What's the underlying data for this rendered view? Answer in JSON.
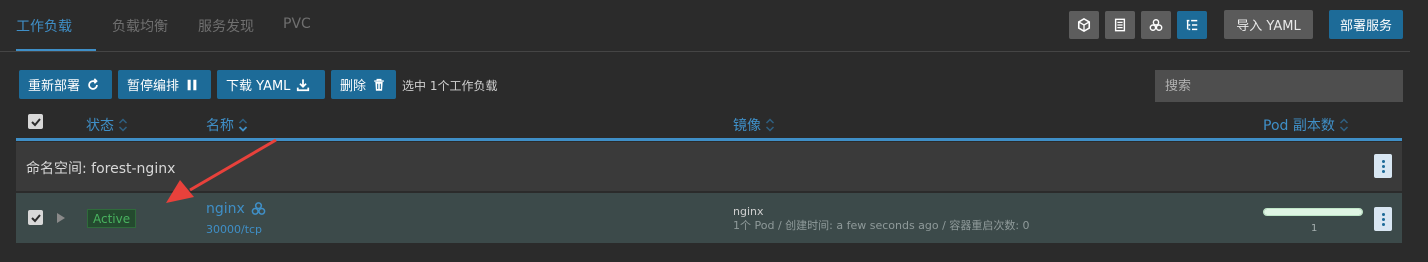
{
  "tabs": [
    {
      "label": "工作负载",
      "active": true
    },
    {
      "label": "负载均衡",
      "active": false
    },
    {
      "label": "服务发现",
      "active": false
    },
    {
      "label": "PVC",
      "active": false
    }
  ],
  "view_buttons": [
    "cube-icon",
    "list-icon",
    "cluster-icon",
    "tree-list-icon"
  ],
  "header_buttons": {
    "import": "导入 YAML",
    "deploy": "部署服务"
  },
  "actions": {
    "redeploy": "重新部署",
    "pause": "暂停编排",
    "download": "下载 YAML",
    "delete": "删除",
    "selected": "选中 1个工作负载"
  },
  "search": {
    "placeholder": "搜索"
  },
  "columns": {
    "status": "状态",
    "name": "名称",
    "image": "镜像",
    "pods": "Pod 副本数"
  },
  "namespace": {
    "label": "命名空间: forest-nginx"
  },
  "workload": {
    "status": "Active",
    "name": "nginx",
    "port": "30000/tcp",
    "image": "nginx",
    "detail": "1个 Pod / 创建时间: a few seconds ago / 容器重启次数: 0",
    "pod_count": "1",
    "pod_progress": 1.0,
    "selected": true
  },
  "colors": {
    "accent": "#3f8fc7",
    "primary_button": "#1d6b98",
    "active_badge": "#49b35f",
    "annotation_arrow": "#e8413b"
  }
}
